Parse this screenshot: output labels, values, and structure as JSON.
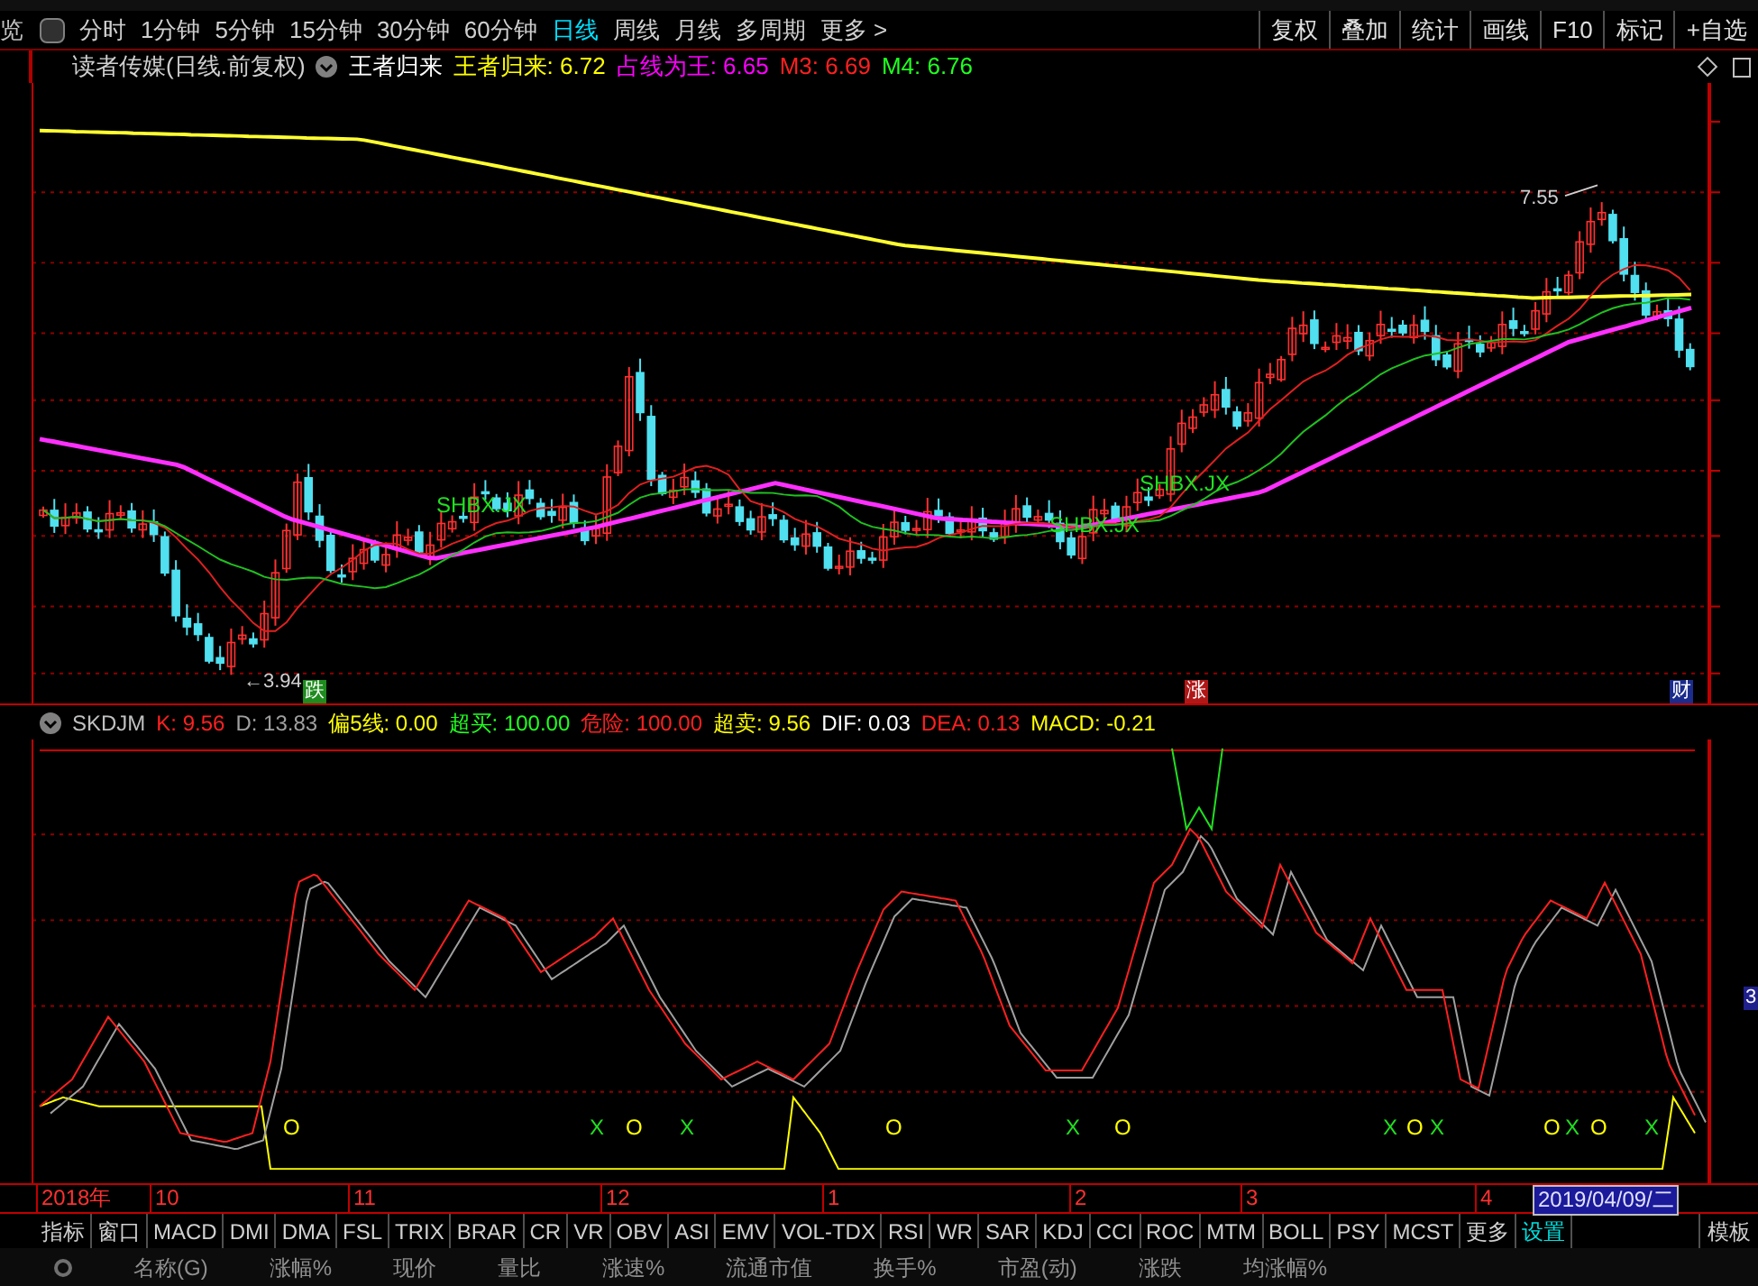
{
  "toolbar": {
    "lead": "览",
    "periods": [
      {
        "label": "分时",
        "selected": false
      },
      {
        "label": "1分钟",
        "selected": false
      },
      {
        "label": "5分钟",
        "selected": false
      },
      {
        "label": "15分钟",
        "selected": false
      },
      {
        "label": "30分钟",
        "selected": false
      },
      {
        "label": "60分钟",
        "selected": false
      },
      {
        "label": "日线",
        "selected": true
      },
      {
        "label": "周线",
        "selected": false
      },
      {
        "label": "月线",
        "selected": false
      },
      {
        "label": "多周期",
        "selected": false
      },
      {
        "label": "更多 >",
        "selected": false
      }
    ],
    "buttons": [
      "复权",
      "叠加",
      "统计",
      "画线",
      "F10",
      "标记",
      "+自选"
    ]
  },
  "chart": {
    "title": "读者传媒(日线.前复权)",
    "legend": [
      {
        "text": "王者归来",
        "color": "#ffffff"
      },
      {
        "text": "王者归来: 6.72",
        "color": "#ffff00"
      },
      {
        "text": "占线为王: 6.65",
        "color": "#ff00ff"
      },
      {
        "text": "M3: 6.69",
        "color": "#ff2020"
      },
      {
        "text": "M4: 6.76",
        "color": "#20ff20"
      }
    ],
    "high_label": "7.55",
    "low_label": "←3.94",
    "signals": [
      "SHBX.JX",
      "SHBX.JX",
      "SHBX.JX"
    ],
    "events": [
      {
        "text": "跌",
        "color": "#1e8c1e"
      },
      {
        "text": "涨",
        "color": "#b01818"
      },
      {
        "text": "财",
        "color": "#1c2c8c"
      }
    ]
  },
  "indicator": {
    "name": "SKDJM",
    "legend": [
      {
        "text": "K: 9.56",
        "color": "#ff2020"
      },
      {
        "text": "D: 13.83",
        "color": "#a0a0a0"
      },
      {
        "text": "偏5线: 0.00",
        "color": "#ffff00"
      },
      {
        "text": "超买: 100.00",
        "color": "#20ff20"
      },
      {
        "text": "危险: 100.00",
        "color": "#ff2020"
      },
      {
        "text": "超卖: 9.56",
        "color": "#ffff00"
      },
      {
        "text": "DIF: 0.03",
        "color": "#ffffff"
      },
      {
        "text": "DEA: 0.13",
        "color": "#ff2020"
      },
      {
        "text": "MACD: -0.21",
        "color": "#ffff00"
      }
    ],
    "markers": [
      {
        "text": "O",
        "kind": "o"
      },
      {
        "text": "X",
        "kind": "x"
      },
      {
        "text": "O",
        "kind": "o"
      },
      {
        "text": "X",
        "kind": "x"
      },
      {
        "text": "O",
        "kind": "o"
      },
      {
        "text": "X",
        "kind": "x"
      },
      {
        "text": "O",
        "kind": "o"
      },
      {
        "text": "X",
        "kind": "x"
      },
      {
        "text": "O",
        "kind": "o"
      },
      {
        "text": "X",
        "kind": "x"
      },
      {
        "text": "O",
        "kind": "o"
      },
      {
        "text": "X",
        "kind": "x"
      },
      {
        "text": "O",
        "kind": "o"
      },
      {
        "text": "X",
        "kind": "x"
      }
    ],
    "axis_tag": "3"
  },
  "date_axis": {
    "labels": [
      "2018年",
      "10",
      "11",
      "12",
      "1",
      "2",
      "3",
      "4"
    ],
    "cursor_date": "2019/04/09/二"
  },
  "indicator_tabs": [
    {
      "label": "指标",
      "kind": "tab"
    },
    {
      "label": "窗口",
      "kind": "tab"
    },
    {
      "label": "MACD",
      "kind": "tab"
    },
    {
      "label": "DMI",
      "kind": "tab"
    },
    {
      "label": "DMA",
      "kind": "tab"
    },
    {
      "label": "FSL",
      "kind": "tab"
    },
    {
      "label": "TRIX",
      "kind": "tab"
    },
    {
      "label": "BRAR",
      "kind": "tab"
    },
    {
      "label": "CR",
      "kind": "tab"
    },
    {
      "label": "VR",
      "kind": "tab"
    },
    {
      "label": "OBV",
      "kind": "tab"
    },
    {
      "label": "ASI",
      "kind": "tab"
    },
    {
      "label": "EMV",
      "kind": "tab"
    },
    {
      "label": "VOL-TDX",
      "kind": "tab"
    },
    {
      "label": "RSI",
      "kind": "tab"
    },
    {
      "label": "WR",
      "kind": "tab"
    },
    {
      "label": "SAR",
      "kind": "tab"
    },
    {
      "label": "KDJ",
      "kind": "tab"
    },
    {
      "label": "CCI",
      "kind": "tab"
    },
    {
      "label": "ROC",
      "kind": "tab"
    },
    {
      "label": "MTM",
      "kind": "tab"
    },
    {
      "label": "BOLL",
      "kind": "tab"
    },
    {
      "label": "PSY",
      "kind": "tab"
    },
    {
      "label": "MCST",
      "kind": "tab"
    },
    {
      "label": "更多",
      "kind": "tab"
    },
    {
      "label": "设置",
      "kind": "accent"
    }
  ],
  "template_button": "模板",
  "columns": [
    "名称(G)",
    "涨幅%",
    "现价",
    "量比",
    "涨速%",
    "流通市值",
    "换手%",
    "市盈(动)",
    "涨跌",
    "均涨幅%"
  ]
}
